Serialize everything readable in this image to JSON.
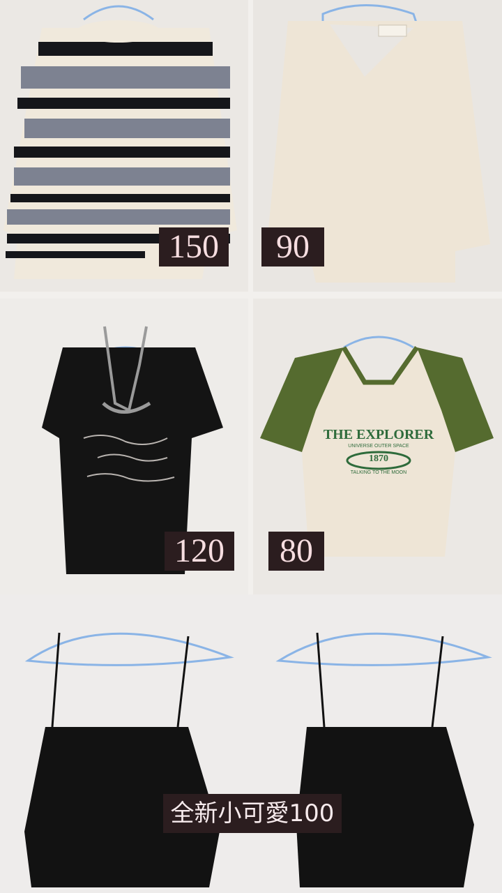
{
  "collage": {
    "items": [
      {
        "name": "striped knit sweater",
        "price": "150"
      },
      {
        "name": "cream v-neck sweater",
        "price": "90"
      },
      {
        "name": "black tee with halter",
        "price": "120"
      },
      {
        "name": "explorer raglan tee",
        "price": "80",
        "print": {
          "title": "THE EXPLORER",
          "subtitle": "UNIVERSE OUTER SPACE",
          "badge": "1870",
          "tagline": "TALKING TO THE MOON"
        }
      },
      {
        "name": "black camisole pair",
        "price": "全新小可愛100"
      }
    ]
  },
  "colors": {
    "label_bg": "#2b1d1f",
    "label_text": "#f6dde0",
    "sweater_grey": "#7d8291",
    "sweater_black": "#15161a",
    "cream": "#eee5d6",
    "olive": "#556b2f",
    "hanger_blue": "#8ab4e6"
  }
}
